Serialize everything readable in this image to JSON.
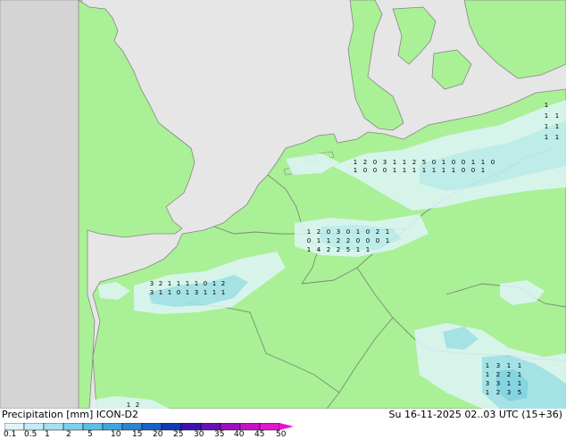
{
  "legend": {
    "title": "Precipitation [mm]  ICON-D2",
    "datetime": "Su 16-11-2025 02..03 UTC (15+36)",
    "ticks": [
      "0.1",
      "0.5",
      "1",
      "2",
      "5",
      "10",
      "15",
      "20",
      "25",
      "30",
      "35",
      "40",
      "45",
      "50"
    ],
    "colors": [
      "#dff5fa",
      "#c2ecf7",
      "#a3e0f3",
      "#7fd0ee",
      "#58bfe8",
      "#3aa7e0",
      "#2a86d4",
      "#1c62c6",
      "#1238b7",
      "#3a14b0",
      "#6b0fb4",
      "#9c10bc",
      "#c811c4",
      "#e513cf"
    ]
  },
  "map": {
    "land_color": "#aaf096",
    "uncovered_land_color": "#d4d4d4",
    "sea_color": "#e6e6e6",
    "border_color": "#7a8a7a",
    "coast_color": "#868686"
  },
  "values": {
    "dk": [
      [
        "1",
        ""
      ],
      [
        "1",
        "1"
      ],
      [
        "1",
        "1"
      ],
      [
        "1",
        "1"
      ]
    ],
    "de_north": [
      "1",
      "2",
      "0",
      "3",
      "1",
      "1",
      "2",
      "5",
      "0",
      "1",
      "0",
      "0",
      "1",
      "1",
      "0",
      "1",
      "0",
      "0",
      "0",
      "1",
      "1",
      "1",
      "1",
      "1",
      "1",
      "1",
      "0",
      "0",
      "1"
    ],
    "nl_be_band": [
      "1",
      "2",
      "0",
      "3",
      "0",
      "1",
      "0",
      "2",
      "1",
      "0",
      "1",
      "1",
      "2",
      "2",
      "0",
      "0",
      "0",
      "1",
      "1",
      "4",
      "2",
      "2",
      "5",
      "1",
      "1"
    ],
    "fr_north": [
      "3",
      "2",
      "1",
      "1",
      "1",
      "1",
      "0",
      "1",
      "2",
      "3",
      "1",
      "1",
      "0",
      "1",
      "3",
      "1",
      "1",
      "1"
    ],
    "east": [
      "1",
      "3",
      "1",
      "1",
      "1",
      "2",
      "2",
      "1",
      "3",
      "3",
      "1",
      "1",
      "1",
      "2",
      "3",
      "5"
    ],
    "south_corner": [
      "1",
      "2"
    ]
  }
}
